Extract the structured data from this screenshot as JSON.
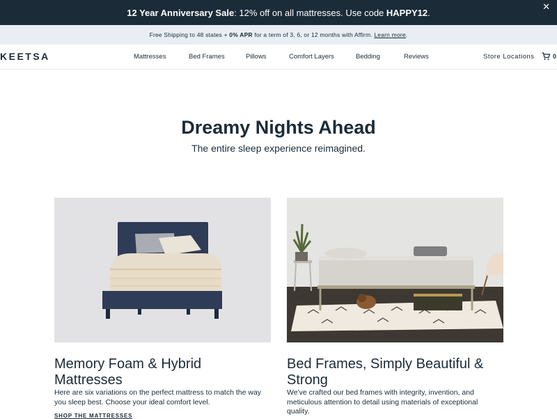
{
  "announcement": {
    "bold_lead": "12 Year Anniversary Sale",
    "middle": ": 12% off on all mattresses. Use code ",
    "code": "HAPPY12",
    "tail": ".",
    "close_glyph": "✕"
  },
  "shipping": {
    "lead": "Free Shipping to 48 states + ",
    "apr": "0% APR",
    "mid": " for a term of 3, 6, or 12 months with Affirm. ",
    "link": "Learn more",
    "tail": "."
  },
  "nav": {
    "logo": "KEETSA",
    "items": [
      "Mattresses",
      "Bed Frames",
      "Pillows",
      "Comfort Layers",
      "Bedding",
      "Reviews"
    ],
    "store": "Store Locations",
    "cart_count": "0",
    "cart_icon": "cart-icon"
  },
  "hero": {
    "title": "Dreamy Nights Ahead",
    "subtitle": "The entire sleep experience reimagined."
  },
  "cards": [
    {
      "title_line1": "Memory Foam & Hybrid",
      "title_line2": "Mattresses",
      "desc_line1": "Here are six variations on the perfect mattress to match the way",
      "desc_line2": "you sleep best. Choose your ideal comfort level.",
      "link": "SHOP THE MATTRESSES"
    },
    {
      "title_line1": "Bed Frames, Simply Beautiful &",
      "title_line2": "Strong",
      "desc_line1": "We've crafted our bed frames with integrity, invention, and",
      "desc_line2": "meticulous attention to detail using materials of exceptional",
      "desc_line3": "quality."
    }
  ],
  "colors": {
    "navy": "#1b2b38",
    "announce_bg": "#1b2b38",
    "shipping_bg": "#e8eef3",
    "bed_blue": "#2f3c57"
  }
}
